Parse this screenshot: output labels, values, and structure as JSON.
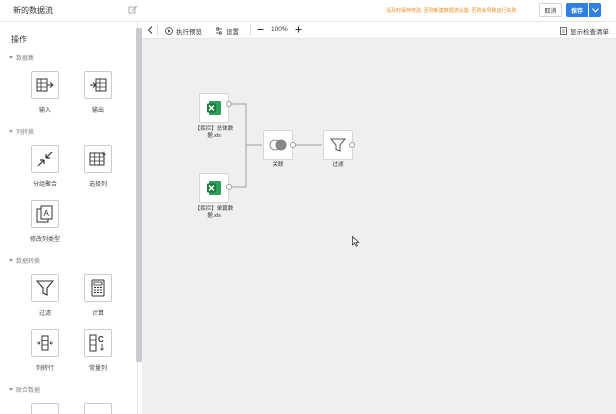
{
  "header": {
    "title": "新的数据流",
    "notice": "请及时保存修改, 否则新建数据流设置, 否则会导致运行失败",
    "cancel_label": "取消",
    "save_label": "保存"
  },
  "sidebar": {
    "heading": "操作",
    "sections": [
      {
        "title": "数据集",
        "tools": [
          {
            "label": "输入",
            "icon": "input-icon"
          },
          {
            "label": "输出",
            "icon": "output-icon"
          }
        ]
      },
      {
        "title": "列转换",
        "tools": [
          {
            "label": "分组聚合",
            "icon": "group-aggregate-icon"
          },
          {
            "label": "选择列",
            "icon": "select-columns-icon"
          },
          {
            "label": "修改列类型",
            "icon": "change-column-type-icon"
          }
        ]
      },
      {
        "title": "数据转换",
        "tools": [
          {
            "label": "过滤",
            "icon": "filter-icon"
          },
          {
            "label": "计算",
            "icon": "calculator-icon"
          },
          {
            "label": "列转行",
            "icon": "column-to-row-icon"
          },
          {
            "label": "常量列",
            "icon": "constant-column-icon"
          }
        ]
      },
      {
        "title": "联合数据",
        "tools": []
      }
    ]
  },
  "toolbar": {
    "run_preview": "执行预览",
    "settings": "设置",
    "zoom": "100%",
    "check_list": "显示检查清单"
  },
  "flow": {
    "nodes": [
      {
        "label": "【挥拦】总体数据.xls",
        "icon": "excel-icon"
      },
      {
        "label": "【挥拦】单篇数据.xls",
        "icon": "excel-icon"
      },
      {
        "label": "关联",
        "icon": "join-icon"
      },
      {
        "label": "过滤",
        "icon": "filter-icon"
      }
    ]
  },
  "colors": {
    "accent": "#2f80e1",
    "notice": "#f08a24",
    "excel": "#1d7a3e",
    "canvas": "#efeff0"
  }
}
